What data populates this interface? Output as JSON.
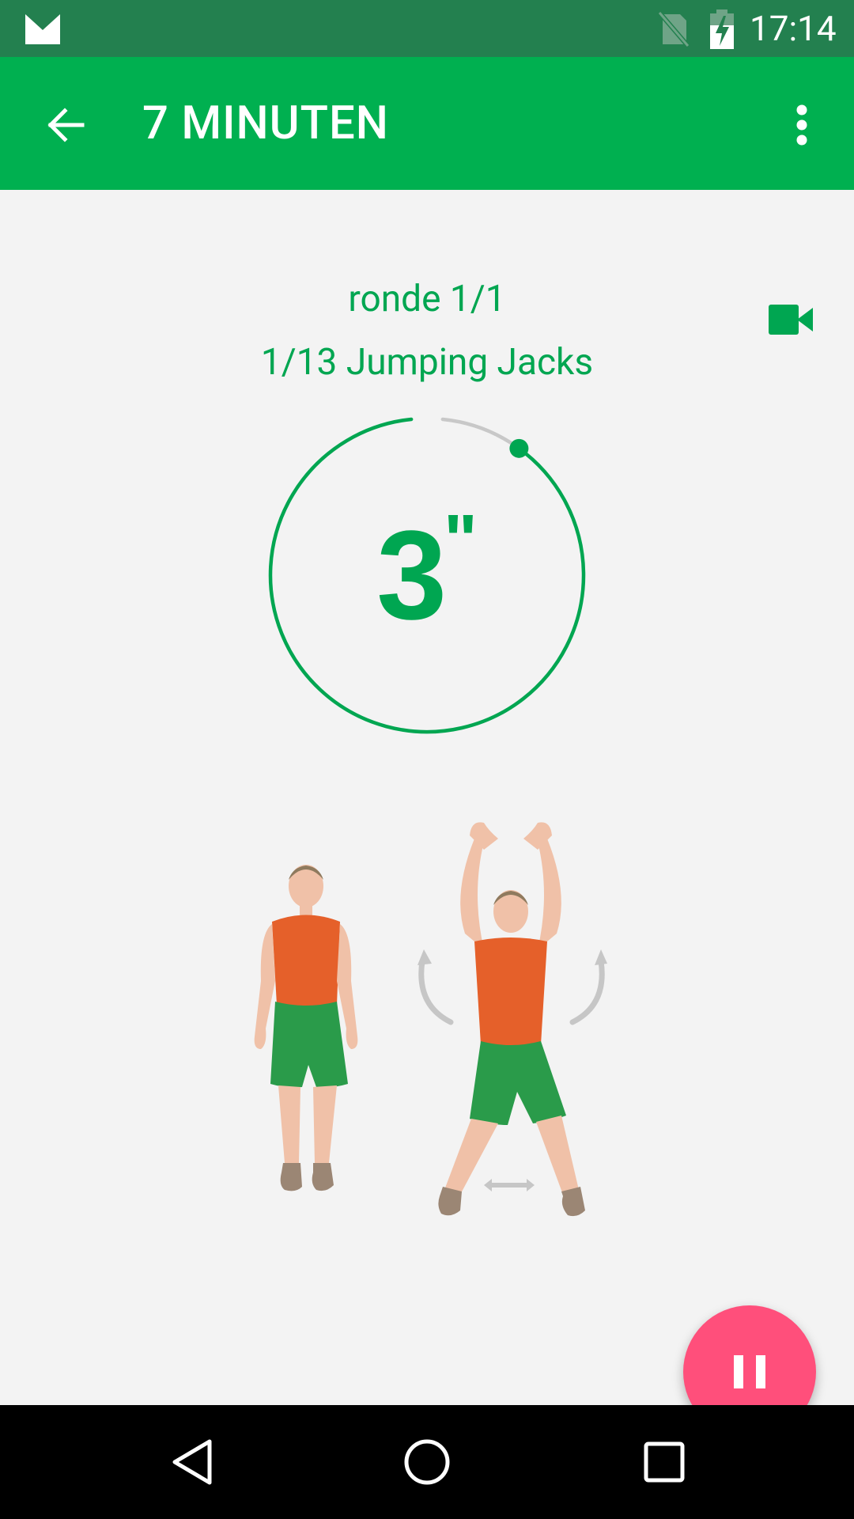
{
  "status_bar": {
    "time": "17:14",
    "icons": [
      "gmail-icon",
      "no-sim-icon",
      "battery-charging-icon"
    ]
  },
  "app_bar": {
    "title": "7 MINUTEN",
    "back_icon": "arrow-back-icon",
    "menu_icon": "more-vert-icon"
  },
  "workout": {
    "round_label": "ronde 1/1",
    "exercise_label": "1/13 Jumping Jacks",
    "countdown_value": "3",
    "countdown_unit": "\"",
    "progress_fraction": 0.1,
    "video_icon": "videocam-icon",
    "illustration": "jumping-jacks-illustration"
  },
  "fab": {
    "icon": "pause-icon"
  },
  "nav_bar": {
    "icons": [
      "back-triangle-icon",
      "home-circle-icon",
      "recents-square-icon"
    ]
  },
  "colors": {
    "status_bar": "#23804f",
    "app_bar": "#00b050",
    "accent_green": "#00a651",
    "fab": "#ff4f7b",
    "background": "#f3f3f3"
  }
}
